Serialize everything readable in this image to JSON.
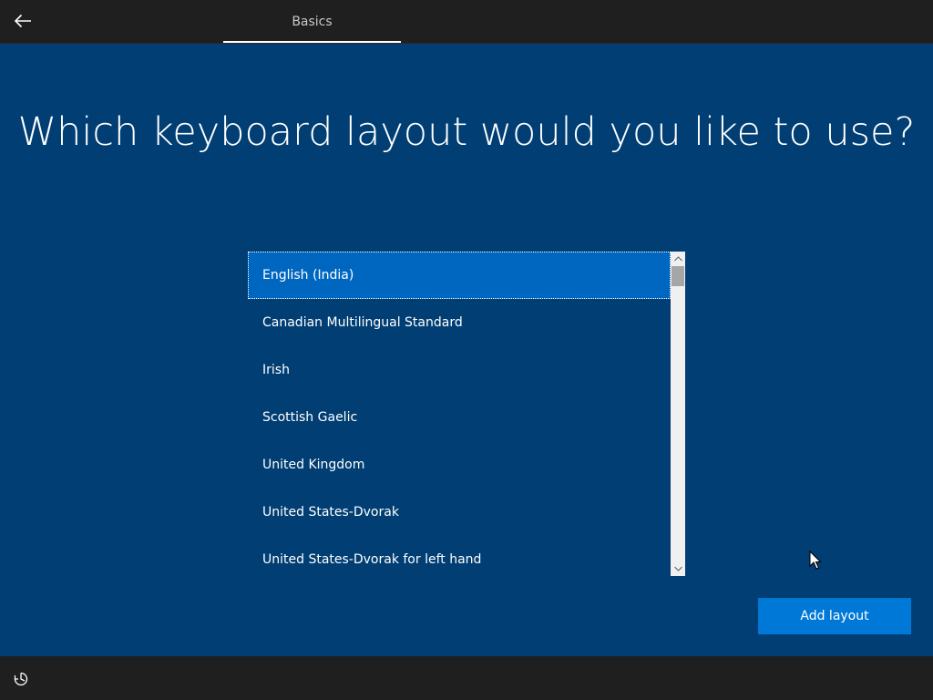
{
  "header": {
    "back_icon": "arrow-left-icon",
    "tabs": [
      {
        "label": "Basics",
        "active": true
      }
    ]
  },
  "main": {
    "title": "Which keyboard layout would you like to use?",
    "layouts": [
      {
        "label": "English (India)",
        "selected": true
      },
      {
        "label": "Canadian Multilingual Standard",
        "selected": false
      },
      {
        "label": "Irish",
        "selected": false
      },
      {
        "label": "Scottish Gaelic",
        "selected": false
      },
      {
        "label": "United Kingdom",
        "selected": false
      },
      {
        "label": "United States-Dvorak",
        "selected": false
      },
      {
        "label": "United States-Dvorak for left hand",
        "selected": false
      }
    ],
    "add_button_label": "Add layout"
  },
  "footer": {
    "ease_of_access_icon": "ease-of-access-icon"
  },
  "colors": {
    "background": "#003e73",
    "bar": "#1f1f1f",
    "selection": "#0067c0",
    "accent_button": "#0078d7"
  }
}
